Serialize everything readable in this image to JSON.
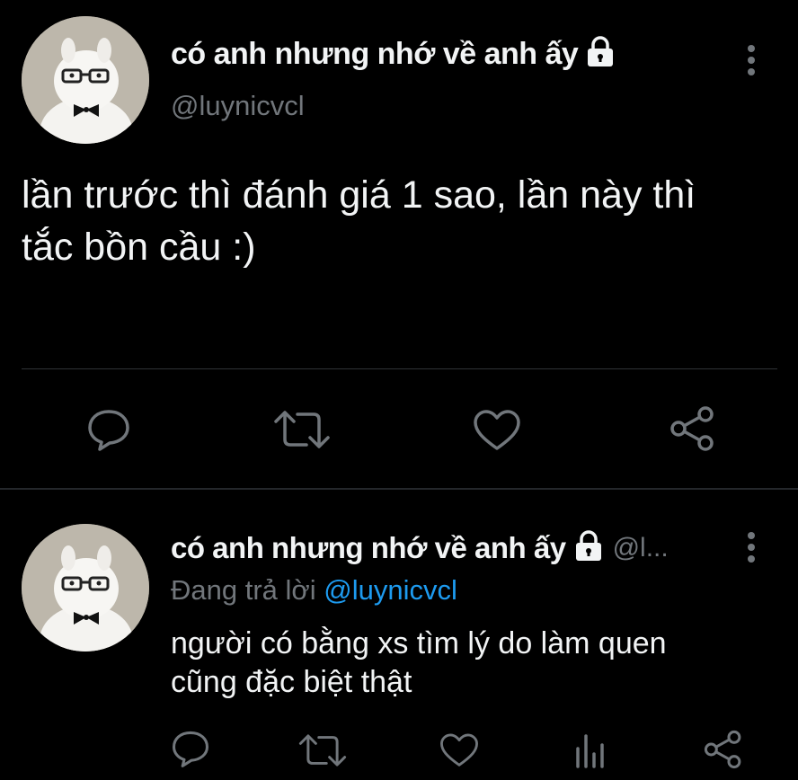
{
  "main_tweet": {
    "display_name": "có anh nhưng nhớ về anh ấy",
    "handle": "@luynicvcl",
    "text_line1": "lần trước thì đánh giá 1 sao, lần này thì",
    "text_line2": "tắc bồn cầu :)"
  },
  "reply_tweet": {
    "display_name": "có anh nhưng nhớ về anh ấy",
    "handle_truncated": "@l...",
    "replying_to_prefix": "Đang trả lời",
    "replying_to_handle": "@luynicvcl",
    "text_line1": "người có bằng xs tìm lý do làm quen",
    "text_line2": "cũng đặc biệt thật"
  },
  "icons": {
    "lock": "lock-icon",
    "more": "more-vertical-icon",
    "reply": "reply-icon",
    "retweet": "retweet-icon",
    "like": "heart-icon",
    "share": "share-icon",
    "analytics": "analytics-icon"
  },
  "colors": {
    "background": "#000000",
    "text": "#f2f4f5",
    "secondary": "#71767b",
    "accent": "#1d9bf0",
    "icon": "#71767b"
  }
}
